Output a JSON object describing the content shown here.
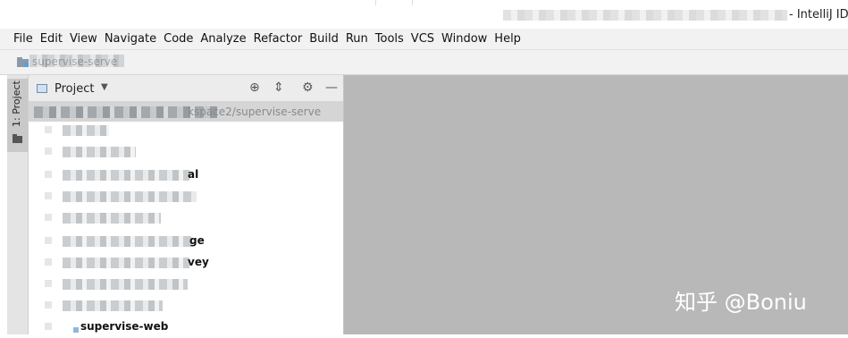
{
  "window": {
    "title_suffix": "- IntelliJ ID"
  },
  "menubar": {
    "items": [
      "File",
      "Edit",
      "View",
      "Navigate",
      "Code",
      "Analyze",
      "Refactor",
      "Build",
      "Run",
      "Tools",
      "VCS",
      "Window",
      "Help"
    ]
  },
  "navbar": {
    "breadcrumb": "supervise-serve"
  },
  "toolstrip": {
    "project_tab_label": "1: Project"
  },
  "project_panel": {
    "title": "Project",
    "root_path_visible": "kspace2/supervise-serve",
    "rows": [
      {
        "tail": ""
      },
      {
        "tail": ""
      },
      {
        "tail": "al"
      },
      {
        "tail": ""
      },
      {
        "tail": ""
      },
      {
        "tail": "ge"
      },
      {
        "tail": "vey"
      },
      {
        "tail": ""
      },
      {
        "tail": ""
      },
      {
        "tail": "supervise-web"
      }
    ]
  },
  "watermark": {
    "text": "知乎 @Boniu"
  },
  "colors": {
    "editor_bg": "#b8b8b8",
    "panel_header_bg": "#ececec",
    "menubar_bg": "#f2f2f2",
    "selected_row_bg": "#d5d5d5"
  }
}
